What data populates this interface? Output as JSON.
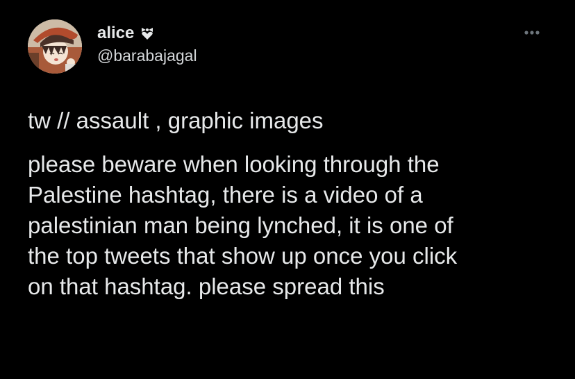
{
  "author": {
    "display_name": "alice",
    "name_emoji": "heart-bow-icon",
    "handle": "@barabajagal",
    "avatar": "anime-avatar"
  },
  "more_menu": {
    "icon": "more-dots-icon"
  },
  "tweet": {
    "content_warning": "tw // assault , graphic images",
    "body_lines": [
      "please beware when looking through the",
      "Palestine hashtag, there is a video of a",
      "palestinian man being lynched, it is one of",
      "the top tweets that show up once you click",
      "on that hashtag. please spread this"
    ]
  },
  "colors": {
    "background": "#000000",
    "text": "#e7e9ea",
    "secondary_text": "#d3d6d8"
  }
}
